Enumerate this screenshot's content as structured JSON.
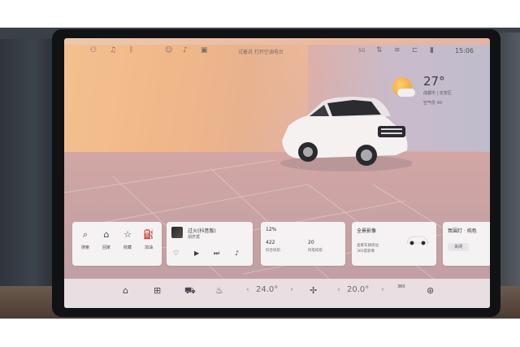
{
  "status_bar": {
    "notice": "试着说 打开空调电台",
    "signal_text": "5G",
    "time": "15:06",
    "icons": [
      "user-icon",
      "bell-icon",
      "bluetooth-icon",
      "profile-icon",
      "microphone-icon",
      "camera-icon",
      "network-icon",
      "wifi-icon",
      "car-link-icon",
      "battery-icon"
    ]
  },
  "weather": {
    "temperature": "27°",
    "location": "成都市 | 定安区",
    "air_quality": "空气优 40"
  },
  "cards": {
    "navigation": {
      "items": [
        {
          "label": "搜索",
          "icon": "search-icon"
        },
        {
          "label": "回家",
          "icon": "home-icon"
        },
        {
          "label": "收藏",
          "icon": "star-icon"
        },
        {
          "label": "加油",
          "icon": "fuel-icon"
        }
      ]
    },
    "music": {
      "title": "过火(抖音版)",
      "artist": "胡彦斌",
      "controls": [
        "heart-icon",
        "play-icon",
        "next-icon",
        "music-note-icon"
      ]
    },
    "energy": {
      "battery": "12%",
      "consumption_value": "422",
      "consumption_label": "综合续航",
      "electric_value": "20",
      "electric_label": "纯电续航"
    },
    "camera": {
      "title": "全景影像",
      "desc_line1": "查看车辆周边",
      "desc_line2": "360度影像"
    },
    "light": {
      "title": "氛围灯 · 纯色",
      "button": "关闭"
    }
  },
  "dock": {
    "icons": [
      "home-icon",
      "apps-grid-icon",
      "car-icon",
      "seat-heat-icon",
      "fan-icon",
      "rear-defrost-icon",
      "camera-360-icon",
      "steering-heat-icon"
    ],
    "temp_left": "24.0°",
    "temp_right": "20.0°",
    "label_360": "360"
  }
}
